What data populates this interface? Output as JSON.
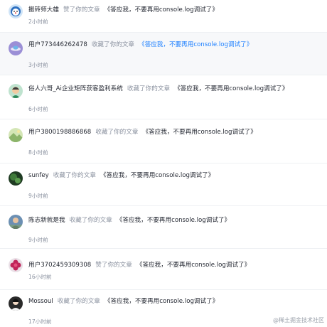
{
  "notifications": [
    {
      "user": "搬砖师大雄",
      "action": "赞了你的文章",
      "article": "《答应我，不要再用console.log调试了》",
      "time": "2小时前",
      "avatar": "cartoon-avatar-icon",
      "highlight": false,
      "link": false
    },
    {
      "user": "用户773446262478",
      "action": "收藏了你的文章",
      "article": "《答应我，不要再用console.log调试了》",
      "time": "3小时前",
      "avatar": "ufo-avatar-icon",
      "highlight": true,
      "link": true
    },
    {
      "user": "俗人六哥_Ai企业矩阵获客盈利系统",
      "action": "收藏了你的文章",
      "article": "《答应我，不要再用console.log调试了》",
      "time": "6小时前",
      "avatar": "character-avatar-icon",
      "highlight": false,
      "link": false
    },
    {
      "user": "用户3800198886868",
      "action": "收藏了你的文章",
      "article": "《答应我，不要再用console.log调试了》",
      "time": "8小时前",
      "avatar": "landscape-avatar-icon",
      "highlight": false,
      "link": false
    },
    {
      "user": "sunfey",
      "action": "收藏了你的文章",
      "article": "《答应我，不要再用console.log调试了》",
      "time": "9小时前",
      "avatar": "nature-avatar-icon",
      "highlight": false,
      "link": false
    },
    {
      "user": "陈志新就是我",
      "action": "收藏了你的文章",
      "article": "《答应我，不要再用console.log调试了》",
      "time": "9小时前",
      "avatar": "photo-avatar-icon",
      "highlight": false,
      "link": false
    },
    {
      "user": "用户3702459309308",
      "action": "赞了你的文章",
      "article": "《答应我，不要再用console.log调试了》",
      "time": "16小时前",
      "avatar": "flower-avatar-icon",
      "highlight": false,
      "link": false
    },
    {
      "user": "Mossoul",
      "action": "收藏了你的文章",
      "article": "《答应我，不要再用console.log调试了》",
      "time": "17小时前",
      "avatar": "portrait-avatar-icon",
      "highlight": false,
      "link": false
    }
  ],
  "watermark": "@稀土掘金技术社区",
  "colors": {
    "link": "#1e80ff",
    "muted": "#8a919f",
    "text": "#252933",
    "highlight_bg": "#f7f8fa"
  }
}
